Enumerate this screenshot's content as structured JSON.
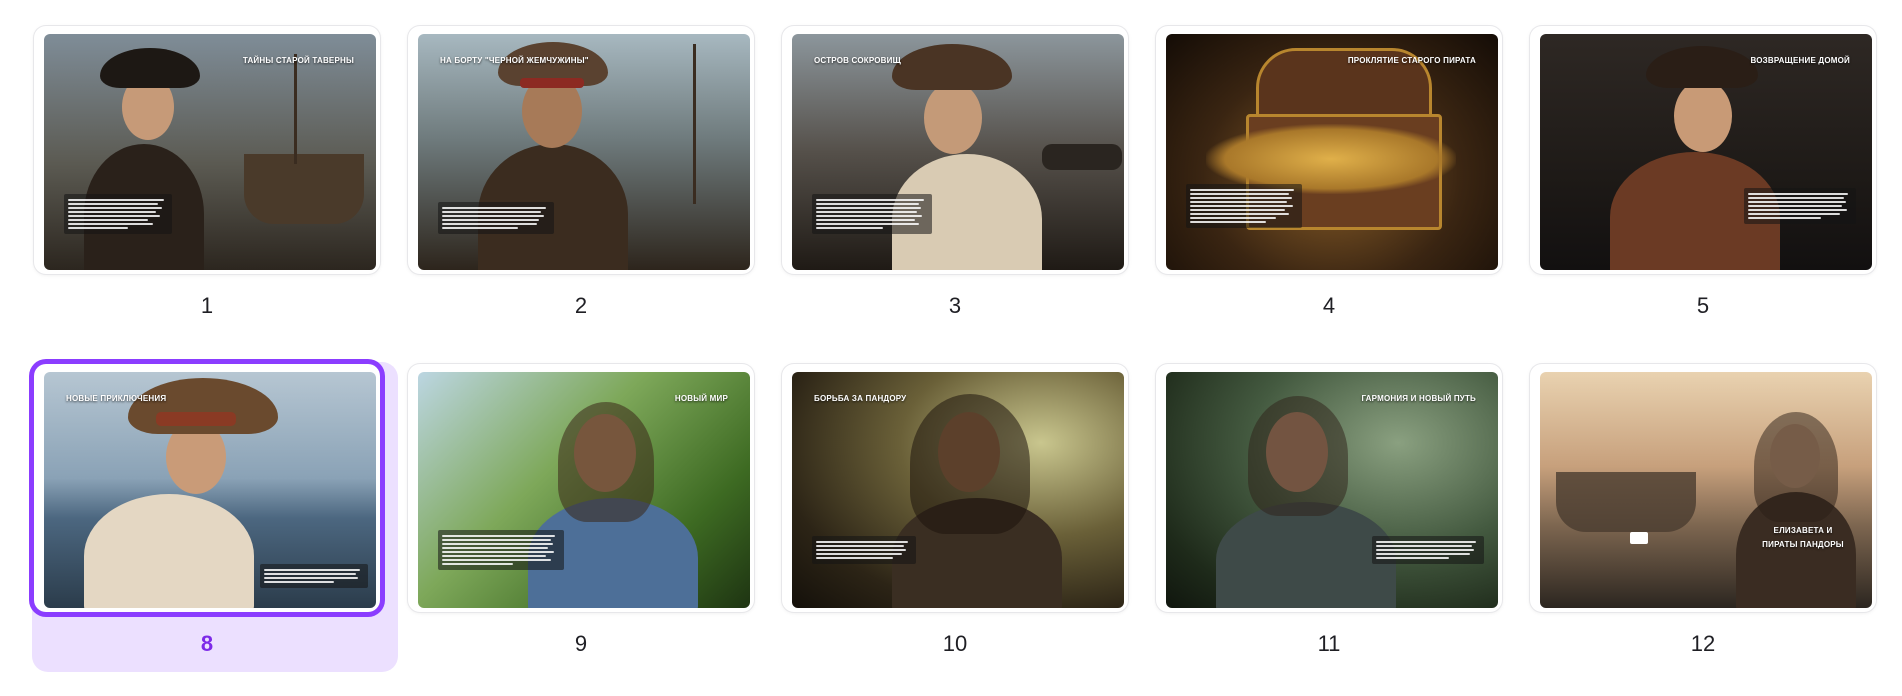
{
  "pages": [
    {
      "number": "1",
      "title": "ТАЙНЫ СТАРОЙ ТАВЕРНЫ",
      "selected": false,
      "colors": [
        "#6d7a86",
        "#3b342c",
        "#1c1a18"
      ]
    },
    {
      "number": "2",
      "title": "НА БОРТУ \"ЧЕРНОЙ ЖЕМЧУЖИНЫ\"",
      "selected": false,
      "colors": [
        "#8ea2ad",
        "#4a3a2a",
        "#1e1a16"
      ]
    },
    {
      "number": "3",
      "title": "ОСТРОВ СОКРОВИЩ",
      "selected": false,
      "colors": [
        "#7d8890",
        "#3d3128",
        "#1c1814"
      ]
    },
    {
      "number": "4",
      "title": "ПРОКЛЯТИЕ СТАРОГО ПИРАТА",
      "selected": false,
      "colors": [
        "#5a3a1a",
        "#b8862e",
        "#1f140a"
      ]
    },
    {
      "number": "5",
      "title": "ВОЗВРАЩЕНИЕ ДОМОЙ",
      "selected": false,
      "colors": [
        "#2a2420",
        "#5a3c28",
        "#141210"
      ]
    },
    {
      "number": "8",
      "title": "НОВЫЕ ПРИКЛЮЧЕНИЯ",
      "selected": true,
      "colors": [
        "#a8bccb",
        "#6a86a0",
        "#2e3c48"
      ]
    },
    {
      "number": "9",
      "title": "НОВЫЙ МИР",
      "selected": false,
      "colors": [
        "#9cc2d6",
        "#4f7a32",
        "#223014"
      ]
    },
    {
      "number": "10",
      "title": "БОРЬБА ЗА ПАНДОРУ",
      "selected": false,
      "colors": [
        "#8a8a5a",
        "#3e3522",
        "#17140e"
      ]
    },
    {
      "number": "11",
      "title": "ГАРМОНИЯ И НОВЫЙ ПУТЬ",
      "selected": false,
      "colors": [
        "#4e6a4a",
        "#2f3f2c",
        "#141a12"
      ]
    },
    {
      "number": "12",
      "title": "ЕЛИЗАВЕТА И ПИРАТЫ ПАНДОРЫ",
      "selected": false,
      "colors": [
        "#e8c9a2",
        "#8a6a52",
        "#2c2620"
      ]
    }
  ]
}
